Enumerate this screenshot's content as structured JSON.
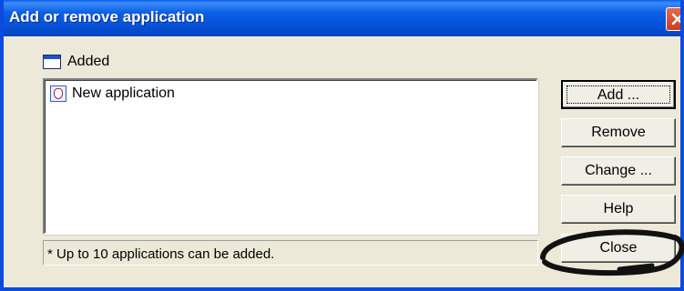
{
  "window": {
    "title": "Add or remove application"
  },
  "added_section": {
    "label": "Added"
  },
  "list": {
    "items": [
      {
        "label": "New application"
      }
    ]
  },
  "status": {
    "text": "* Up to 10 applications can be added."
  },
  "buttons": {
    "add": "Add ...",
    "remove": "Remove",
    "change": "Change ...",
    "help": "Help",
    "close": "Close"
  },
  "icons": {
    "window_close": "close-x-icon",
    "added_header": "window-icon",
    "list_item": "application-icon"
  },
  "colors": {
    "titlebar": "#0553d8",
    "dialog_background": "#ece9d8",
    "close_button": "#d9522f"
  }
}
